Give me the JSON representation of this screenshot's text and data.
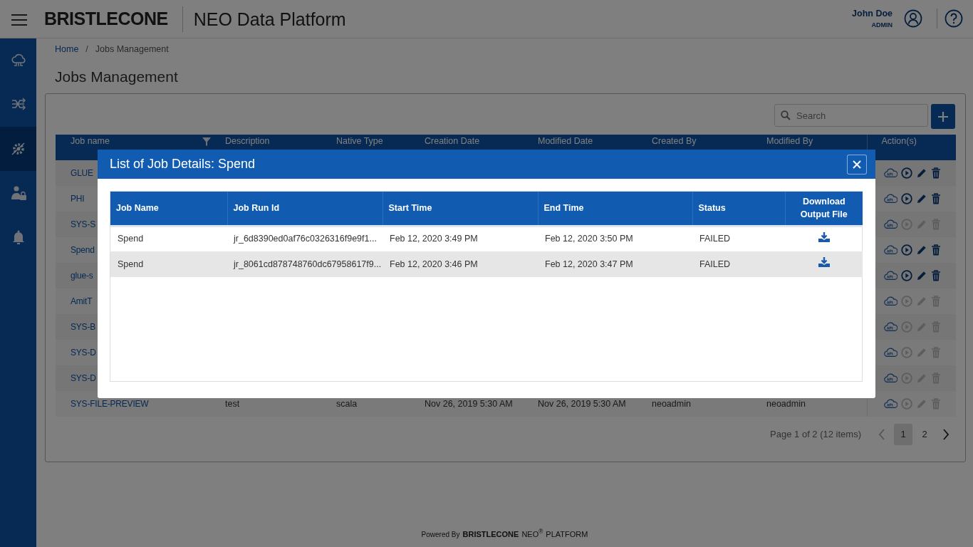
{
  "header": {
    "brand": "BRISTLECONE",
    "app_title": "NEO Data Platform",
    "user_name": "John Doe",
    "user_role": "ADMIN"
  },
  "sidebar": {
    "items": [
      {
        "kind": "cloud",
        "selected": false
      },
      {
        "kind": "flow",
        "selected": false
      },
      {
        "kind": "gear",
        "selected": true
      },
      {
        "kind": "user",
        "selected": false
      },
      {
        "kind": "bell",
        "selected": false
      }
    ]
  },
  "breadcrumb": {
    "items": [
      "Home",
      "Jobs Management"
    ],
    "separator": "/"
  },
  "page_title": "Jobs Management",
  "search": {
    "placeholder": "Search"
  },
  "jobs_table": {
    "columns": [
      "Job name",
      "Description",
      "Native Type",
      "Creation Date",
      "Modified Date",
      "Created By",
      "Modified By",
      "Action(s)"
    ],
    "rows": [
      {
        "cells": [
          "GLUE"
        ],
        "enabled": true
      },
      {
        "cells": [
          "PHI"
        ],
        "enabled": true
      },
      {
        "cells": [
          "SYS-S"
        ],
        "enabled": false
      },
      {
        "cells": [
          "Spend"
        ],
        "enabled": true
      },
      {
        "cells": [
          "glue-s"
        ],
        "enabled": true
      },
      {
        "cells": [
          "AmitT"
        ],
        "enabled": false
      },
      {
        "cells": [
          "SYS-B"
        ],
        "enabled": false
      },
      {
        "cells": [
          "SYS-D"
        ],
        "enabled": false
      },
      {
        "cells": [
          "SYS-D"
        ],
        "enabled": false
      },
      {
        "cells": [
          "SYS-FILE-PREVIEW",
          "test",
          "scala",
          "Nov 26, 2019 5:30 AM",
          "Nov 26, 2019 5:30 AM",
          "neoadmin",
          "neoadmin"
        ],
        "enabled": false
      }
    ]
  },
  "pagination": {
    "summary": "Page 1 of 2 (12 items)",
    "pages": [
      {
        "label": "1",
        "selected": true
      },
      {
        "label": "2",
        "selected": false
      }
    ]
  },
  "modal": {
    "title": "List of Job Details: Spend",
    "columns": [
      "Job Name",
      "Job Run Id",
      "Start Time",
      "End Time",
      "Status",
      "Download Output File"
    ],
    "rows": [
      {
        "cells": [
          "Spend",
          "jr_6d8390ed0af76c0326316f9e9f1...",
          "Feb 12, 2020 3:49 PM",
          "Feb 12, 2020 3:50 PM",
          "FAILED"
        ]
      },
      {
        "cells": [
          "Spend",
          "jr_8061cd878748760dc67958617f9...",
          "Feb 12, 2020 3:46 PM",
          "Feb 12, 2020 3:47 PM",
          "FAILED"
        ]
      }
    ]
  },
  "footer": {
    "prefix": "Powered By",
    "brand": "BRISTLECONE",
    "product": "NEO$^{®}$",
    "suffix": "PLATFORM"
  }
}
